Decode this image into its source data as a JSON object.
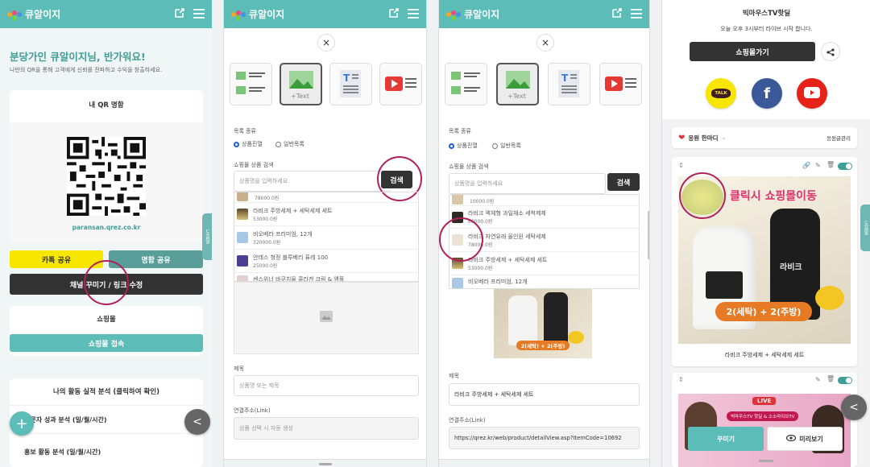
{
  "app": {
    "name": "큐알이지",
    "brand_color": "#5bbcb8",
    "accent_color": "#b0205a"
  },
  "panel1": {
    "welcome": "분당가인 큐알이지님, 반가워요!",
    "subtitle": "나만의 QR을 통해 고객에게 신뢰를 전파하고 수익을 창출하세요.",
    "qr_card_title": "내 QR 명함",
    "qr_url": "paransan.qrez.co.kr",
    "kakao_share": "카톡 공유",
    "card_share": "명함 공유",
    "decorate_link": "채널 꾸미기 / 링크 수정",
    "side_tab": "도움말",
    "mall_title": "쇼핑몰",
    "mall_btn": "쇼핑몰 접속",
    "stats_title": "나의 활동 실적 분석 (클릭하여 확인)",
    "stat1": "방문자 성과 분석 (일/월/시간)",
    "stat2": "홍보 활동 분석 (일/월/시간)"
  },
  "editor": {
    "list_type_label": "목록 종류",
    "radio_product": "상품진열",
    "radio_normal": "일반목록",
    "search_label": "쇼핑몰 상품 검색",
    "search_placeholder": "상품명을 입력하세요",
    "search_btn": "검색",
    "title_label": "제목",
    "link_label": "연결주소(Link)"
  },
  "panel2": {
    "products": [
      {
        "name": "",
        "price": "78000.0원"
      },
      {
        "name": "라비크 주방세제 + 세탁세제 세트",
        "price": "53000.0원"
      },
      {
        "name": "비오베라 프리미엄, 12개",
        "price": "320000.0원"
      },
      {
        "name": "안데스 청정 블루베리 퓨레 100",
        "price": "25000.0원"
      },
      {
        "name": "센스위너 바쿠치올 콜라겐 크림 & 앰플",
        "price": ""
      }
    ],
    "title_placeholder": "상품명 또는 제목",
    "link_placeholder": "상품 선택 시 자동 생성"
  },
  "panel3": {
    "products": [
      {
        "name": "",
        "price": "10000.0원"
      },
      {
        "name": "라비크 액체형 과일채소 세척제제",
        "price": "60000.0원"
      },
      {
        "name": "라비크 자연유래 올인원 세탁세제",
        "price": "78000.0원"
      },
      {
        "name": "라비크 주방세제 + 세탁세제 세트",
        "price": "53000.0원"
      },
      {
        "name": "비오베라 프리미엄, 12개",
        "price": ""
      }
    ],
    "banner_text": "2(세탁) + 2(주방)",
    "title_value": "라비크 주방세제 + 세탁세제 세트",
    "link_value": "https://qrez.kr/web/product/detailView.asp?ItemCode=10692"
  },
  "panel4": {
    "channel_name": "빅마우스TV핫딜",
    "live_notice": "오늘 오후 3시부터 라이브 시작 합니다.",
    "shop_btn": "쇼핑몰가기",
    "kakao_label": "TALK",
    "support_label": "응원 한마디",
    "support_manage": "응원글관리",
    "click_text": "클릭시 쇼핑몰이동",
    "product_brand": "라비크",
    "banner_text": "2(세탁) + 2(주방)",
    "product_caption": "라비크 주방세제 + 세탁세제 세트",
    "live_badge": "LIVE",
    "live_sub": "빅마우스TV 핫딜 & 소소라이브TV",
    "decorate_btn": "꾸미기",
    "preview_btn": "미리보기",
    "side_tab": "도움말"
  }
}
